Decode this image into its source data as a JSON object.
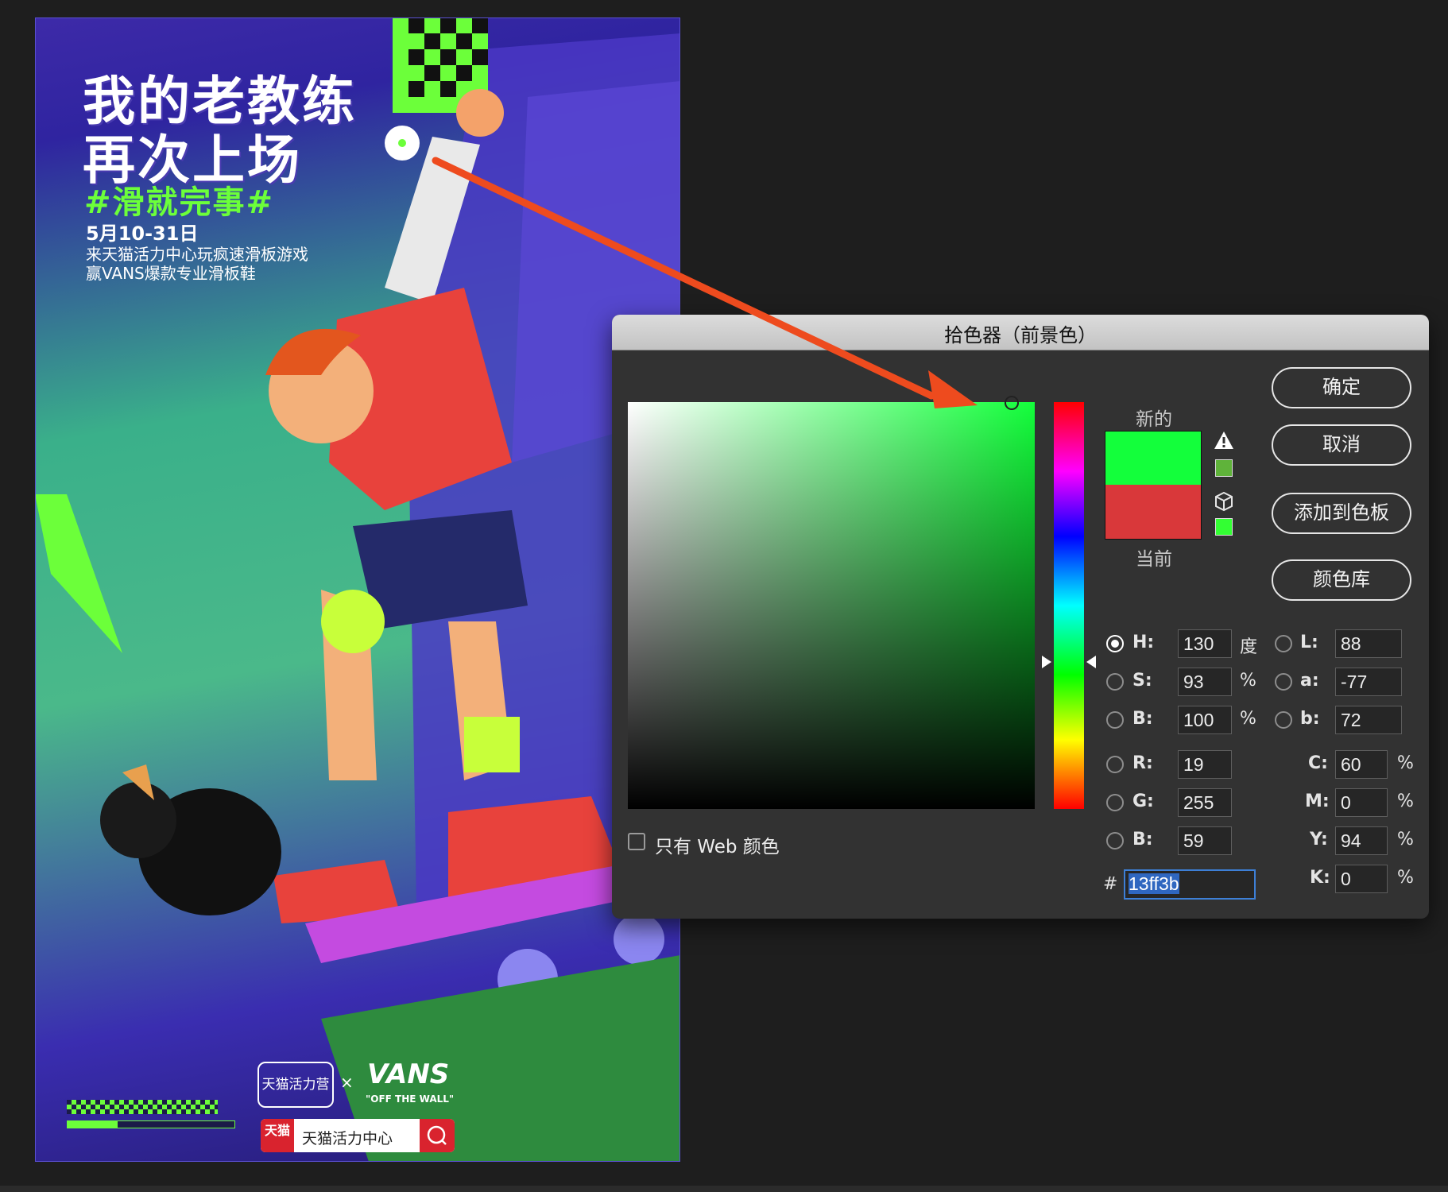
{
  "poster": {
    "title_line1": "我的老教练",
    "title_line2": "再次上场",
    "hashtag": "#滑就完事#",
    "date": "5月10-31日",
    "line1": "来天猫活力中心玩疯速滑板游戏",
    "line2": "赢VANS爆款专业滑板鞋",
    "brand_left": "天猫活力营",
    "brand_x": "×",
    "brand_right": "VANS",
    "brand_tagline": "\"OFF THE WALL\"",
    "tmall_tag": "天猫",
    "search_text": "天猫活力中心",
    "progress_fraction": 0.3
  },
  "dialog": {
    "title": "拾色器（前景色）",
    "new_label": "新的",
    "current_label": "当前",
    "new_color": "#13ff3b",
    "current_color": "#d9383a",
    "gamut_color": "#5fb33a",
    "websafe_color": "#33ff33",
    "buttons": {
      "ok": "确定",
      "cancel": "取消",
      "add_to_swatches": "添加到色板",
      "color_libraries": "颜色库"
    },
    "fields": {
      "H": {
        "label": "H:",
        "value": "130",
        "unit": "度"
      },
      "S": {
        "label": "S:",
        "value": "93",
        "unit": "%"
      },
      "Bri": {
        "label": "B:",
        "value": "100",
        "unit": "%"
      },
      "R": {
        "label": "R:",
        "value": "19"
      },
      "G": {
        "label": "G:",
        "value": "255"
      },
      "Blue": {
        "label": "B:",
        "value": "59"
      },
      "L": {
        "label": "L:",
        "value": "88"
      },
      "a": {
        "label": "a:",
        "value": "-77"
      },
      "b": {
        "label": "b:",
        "value": "72"
      },
      "C": {
        "label": "C:",
        "value": "60",
        "unit": "%"
      },
      "M": {
        "label": "M:",
        "value": "0",
        "unit": "%"
      },
      "Y": {
        "label": "Y:",
        "value": "94",
        "unit": "%"
      },
      "K": {
        "label": "K:",
        "value": "0",
        "unit": "%"
      }
    },
    "hex_hash": "#",
    "hex_value": "13ff3b",
    "web_only_label": "只有 Web 颜色",
    "icons": [
      "warning-icon",
      "cube-icon"
    ]
  },
  "annotation": {
    "arrow_color": "#ee4b1e"
  }
}
